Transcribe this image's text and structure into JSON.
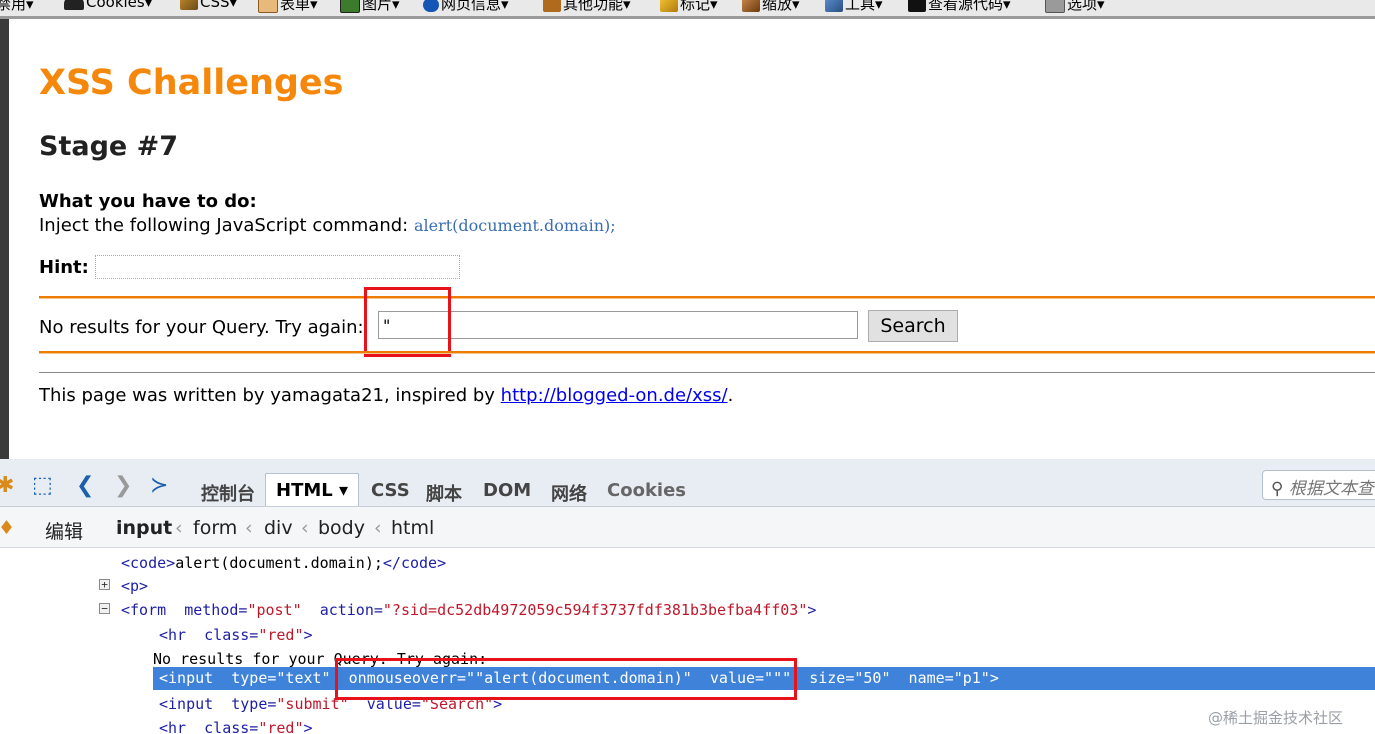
{
  "toolbar": {
    "items": [
      {
        "label": "禁用",
        "icon": "disable-icon"
      },
      {
        "label": "Cookies",
        "icon": "cookie-icon"
      },
      {
        "label": "CSS",
        "icon": "css-icon"
      },
      {
        "label": "表单",
        "icon": "form-icon"
      },
      {
        "label": "图片",
        "icon": "image-icon"
      },
      {
        "label": "网页信息",
        "icon": "info-icon"
      },
      {
        "label": "其他功能",
        "icon": "misc-icon"
      },
      {
        "label": "标记",
        "icon": "outline-icon"
      },
      {
        "label": "缩放",
        "icon": "resize-icon"
      },
      {
        "label": "工具",
        "icon": "tools-icon"
      },
      {
        "label": "查看源代码",
        "icon": "source-icon"
      },
      {
        "label": "选项",
        "icon": "options-icon"
      }
    ]
  },
  "page": {
    "title": "XSS Challenges",
    "stage": "Stage #7",
    "what_to_do": "What you have to do:",
    "inject_text": "Inject the following JavaScript command: ",
    "inject_code": "alert(document.domain);",
    "hint_label": "Hint:",
    "no_results": "No results for your Query. Try again:",
    "query_value": "\"",
    "search_button": "Search",
    "footer_text": "This page was written by yamagata21, inspired by ",
    "footer_link": "http://blogged-on.de/xss/",
    "footer_end": "."
  },
  "devtools": {
    "tabs": [
      "控制台",
      "HTML",
      "CSS",
      "脚本",
      "DOM",
      "网络",
      "Cookies"
    ],
    "active_tab": "HTML",
    "search_placeholder": "根据文本查",
    "edit_label": "编辑",
    "breadcrumbs": [
      "input",
      "form",
      "div",
      "body",
      "html"
    ],
    "tree": {
      "code_open": "<code>",
      "code_text": "alert(document.domain);",
      "code_close": "</code>",
      "p_tag": "<p>",
      "form_tag": "<form",
      "form_attr1": "method=",
      "form_val1": "\"post\"",
      "form_attr2": "action=",
      "form_val2": "\"?sid=dc52db4972059c594f3737fdf381b3befba4ff03\"",
      "form_end": ">",
      "hr_tag": "<hr",
      "hr_attr": "class=",
      "hr_val": "\"red\"",
      "hr_end": ">",
      "no_results_text": "No results for your Query. Try again:",
      "selected_line": "<input  type=\"text\"  onmouseoverr=\"\"alert(document.domain)\"  value=\"\"\"  size=\"50\"  name=\"p1\">",
      "submit_tag": "<input",
      "submit_attr1": "type=",
      "submit_val1": "\"submit\"",
      "submit_attr2": "value=",
      "submit_val2": "\"Search\"",
      "submit_end": ">",
      "hr2_tag": "<hr",
      "hr2_attr": "class=",
      "hr2_val": "\"red\"",
      "hr2_end": ">"
    }
  },
  "watermark": "@稀土掘金技术社区",
  "colors": {
    "title": "#f5870a",
    "highlight": "#e8121b",
    "selected_row": "#3f82d9"
  }
}
